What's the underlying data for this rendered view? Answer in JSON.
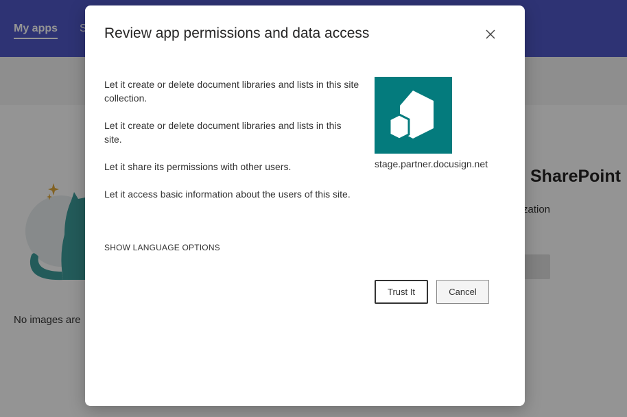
{
  "background": {
    "tabs": [
      {
        "label": "My apps",
        "active": true
      },
      {
        "label": "S",
        "active": false
      }
    ],
    "empty_state_text": "No images are",
    "promo_title": "SharePoint",
    "promo_subtitle": "zation"
  },
  "dialog": {
    "title": "Review app permissions and data access",
    "close_icon": "close-icon",
    "permissions": [
      "Let it create or delete document libraries and lists in this site collection.",
      "Let it create or delete document libraries and lists in this site.",
      "Let it share its permissions with other users.",
      "Let it access basic information about the users of this site."
    ],
    "language_link": "SHOW LANGUAGE OPTIONS",
    "app": {
      "logo_icon": "hexagon-logo-icon",
      "logo_color": "#047b7d",
      "domain": "stage.partner.docusign.net"
    },
    "buttons": {
      "trust": "Trust It",
      "cancel": "Cancel"
    }
  },
  "colors": {
    "header": "#5059c9",
    "overlay": "rgba(0,0,0,0.42)"
  }
}
